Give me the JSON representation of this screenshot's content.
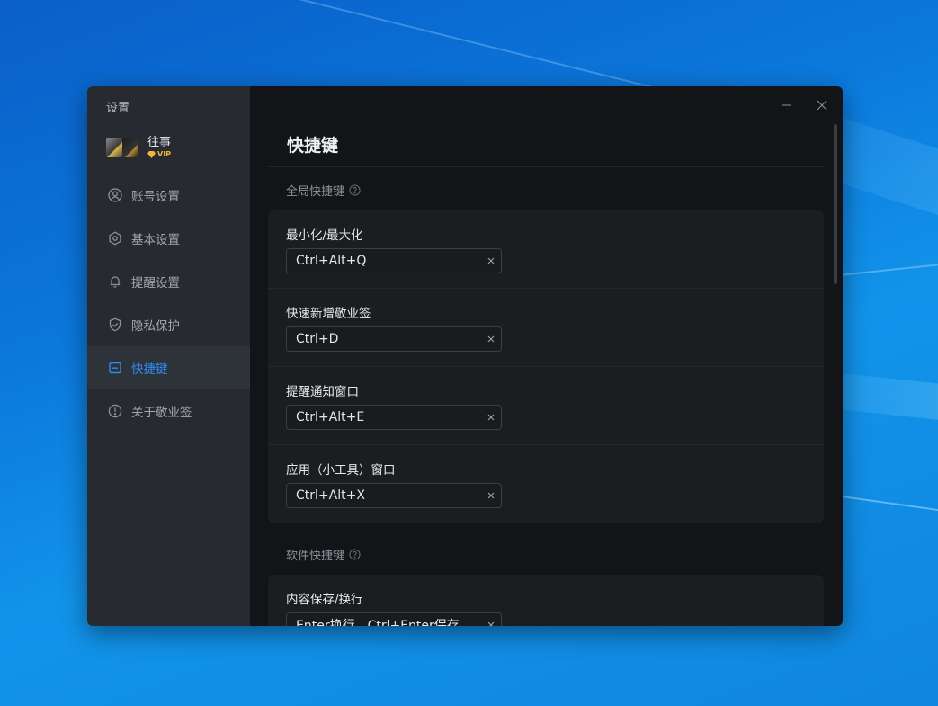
{
  "window": {
    "title": "设置"
  },
  "user": {
    "name": "往事",
    "badge": "VIP"
  },
  "sidebar": {
    "items": [
      {
        "label": "账号设置",
        "icon": "user-icon",
        "active": false
      },
      {
        "label": "基本设置",
        "icon": "gear-icon",
        "active": false
      },
      {
        "label": "提醒设置",
        "icon": "bell-icon",
        "active": false
      },
      {
        "label": "隐私保护",
        "icon": "shield-icon",
        "active": false
      },
      {
        "label": "快捷键",
        "icon": "keyboard-icon",
        "active": true
      },
      {
        "label": "关于敬业签",
        "icon": "info-icon",
        "active": false
      }
    ]
  },
  "main": {
    "title": "快捷键",
    "sections": [
      {
        "label": "全局快捷键",
        "rows": [
          {
            "label": "最小化/最大化",
            "value": "Ctrl+Alt+Q"
          },
          {
            "label": "快速新增敬业签",
            "value": "Ctrl+D"
          },
          {
            "label": "提醒通知窗口",
            "value": "Ctrl+Alt+E"
          },
          {
            "label": "应用（小工具）窗口",
            "value": "Ctrl+Alt+X"
          }
        ]
      },
      {
        "label": "软件快捷键",
        "rows": [
          {
            "label": "内容保存/换行",
            "value": "Enter换行，Ctrl+Enter保存"
          }
        ]
      }
    ]
  },
  "colors": {
    "accent": "#2f8cf4",
    "sidebar_bg": "#272b31",
    "main_bg": "#131417",
    "card_bg": "#1c1d20",
    "vip": "#f2b53c"
  }
}
